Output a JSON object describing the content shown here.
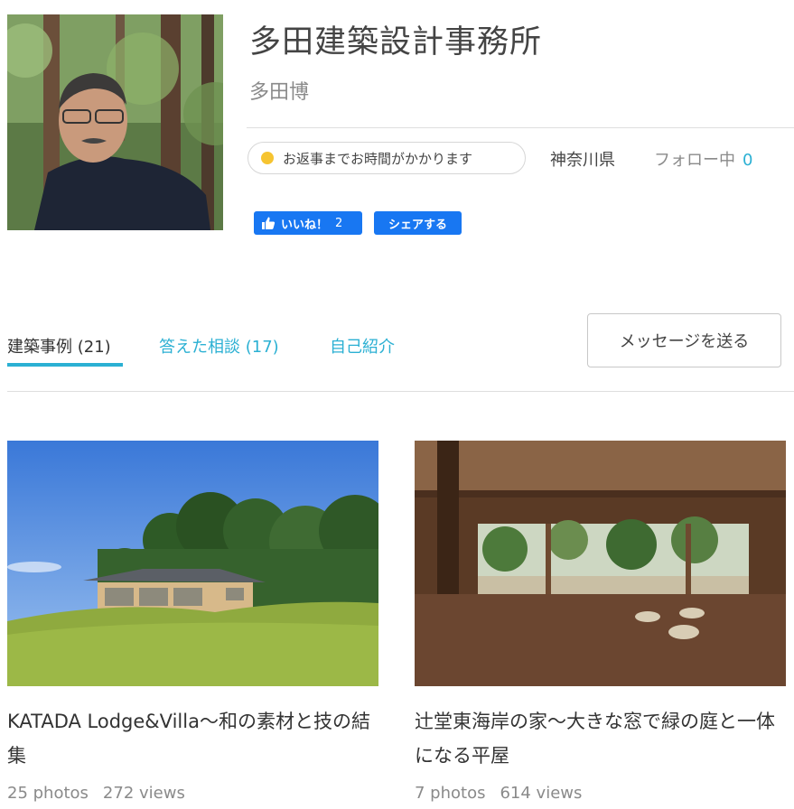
{
  "profile": {
    "office_name": "多田建築設計事務所",
    "person_name": "多田博",
    "response_status": "お返事までお時間がかかります",
    "response_status_color": "#f6c431",
    "location": "神奈川県",
    "follow_label": "フォロー中",
    "follow_count": "0"
  },
  "social": {
    "like_label": "いいね！",
    "like_count": "2",
    "share_label": "シェアする",
    "brand_color": "#1877f2"
  },
  "tabs": [
    {
      "label": "建築事例 (21)",
      "active": true
    },
    {
      "label": "答えた相談 (17)",
      "active": false
    },
    {
      "label": "自己紹介",
      "active": false
    }
  ],
  "message_button": "メッセージを送る",
  "accent_color": "#2bb0d3",
  "projects": [
    {
      "title": "KATADA Lodge&Villa〜和の素材と技の結集",
      "photos": "25 photos",
      "views": "272 views",
      "image": "house-on-green-hill-photo"
    },
    {
      "title": "辻堂東海岸の家〜大きな窓で緑の庭と一体になる平屋",
      "photos": "7 photos",
      "views": "614 views",
      "image": "wooden-interior-garden-view-photo"
    }
  ]
}
